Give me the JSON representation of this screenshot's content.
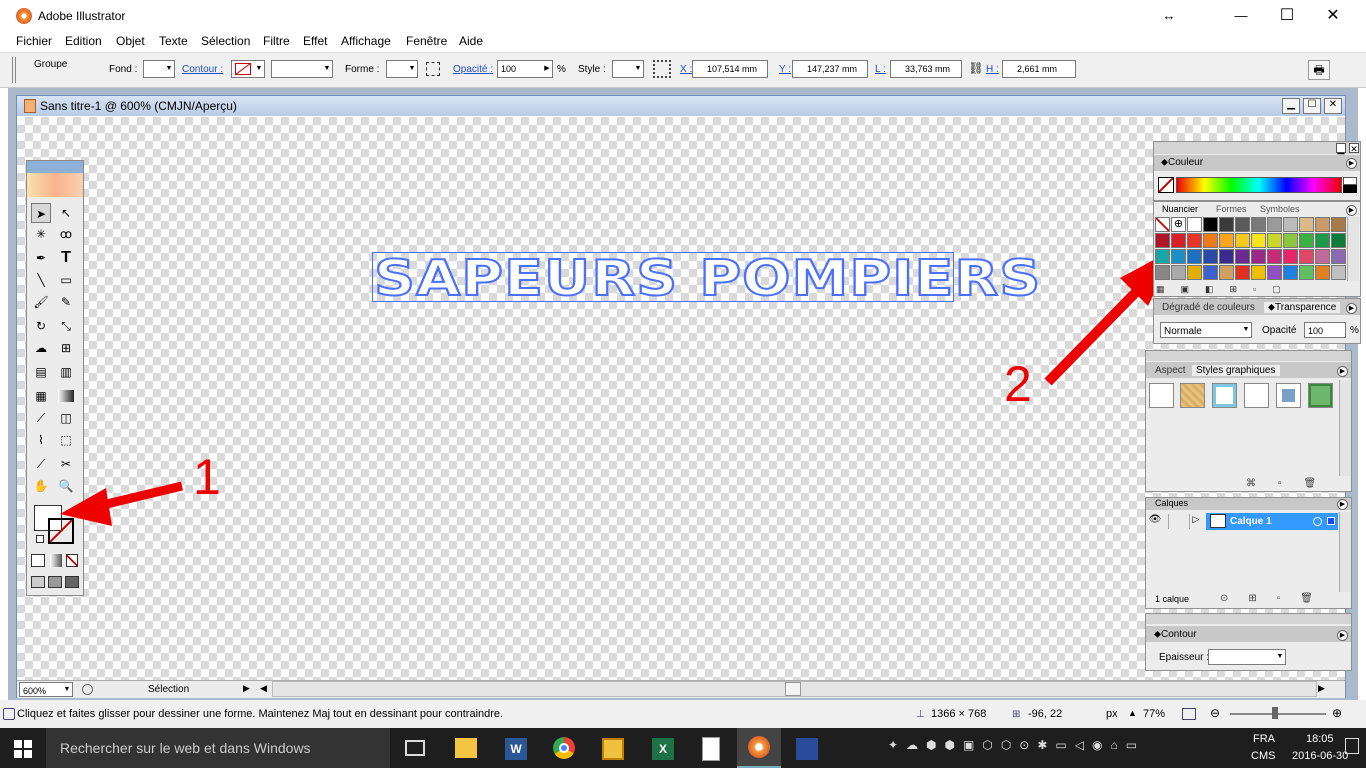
{
  "app": {
    "title": "Adobe Illustrator",
    "move_icon": "↔",
    "min_icon": "—",
    "max_icon": "☐",
    "close_icon": "✕"
  },
  "menu": [
    "Fichier",
    "Edition",
    "Objet",
    "Texte",
    "Sélection",
    "Filtre",
    "Effet",
    "Affichage",
    "Fenêtre",
    "Aide"
  ],
  "control": {
    "group_label": "Groupe",
    "fill_label": "Fond :",
    "stroke_label": "Contour :",
    "shape_label": "Forme :",
    "opacity_label": "Opacité :",
    "opacity_value": "100",
    "percent": "%",
    "style_label": "Style :",
    "x_label": "X :",
    "x_value": "107,514 mm",
    "y_label": "Y :",
    "y_value": "147,237 mm",
    "w_label": "L :",
    "w_value": "33,763 mm",
    "h_label": "H :",
    "h_value": "2,661 mm"
  },
  "document": {
    "title": "Sans titre-1 @ 600% (CMJN/Aperçu)",
    "art_text": "SAPEURS POMPIERS",
    "zoom": "600%",
    "status_mode": "Sélection"
  },
  "annotations": {
    "one": "1",
    "two": "2"
  },
  "panels": {
    "color": {
      "tab": "Couleur"
    },
    "swatches": {
      "tabs": [
        "Nuancier",
        "Formes",
        "Symboles"
      ]
    },
    "gradient": {
      "tabs": [
        "Dégradé de couleurs",
        "Transparence"
      ],
      "blend": "Normale",
      "opacity_label": "Opacité",
      "opacity_value": "100",
      "percent": "%"
    },
    "styles": {
      "tabs": [
        "Aspect",
        "Styles graphiques"
      ]
    },
    "layers": {
      "tab": "Calques",
      "layer_name": "Calque 1",
      "count": "1 calque"
    },
    "stroke": {
      "tab": "Contour",
      "weight_label": "Epaisseur :"
    }
  },
  "status": {
    "hint": "Cliquez et faites glisser pour dessiner une forme. Maintenez Maj tout en dessinant pour contraindre.",
    "size": "1366 × 768",
    "coords": "-96, 22",
    "unit": "px",
    "zoom": "77%"
  },
  "taskbar": {
    "search": "Rechercher sur le web et dans Windows",
    "lang1": "FRA",
    "lang2": "CMS",
    "time": "18:05",
    "date": "2016-06-30"
  },
  "colors": {
    "accent": "#4a70ff",
    "annotation": "#e00000",
    "selection": "#3399ff"
  }
}
